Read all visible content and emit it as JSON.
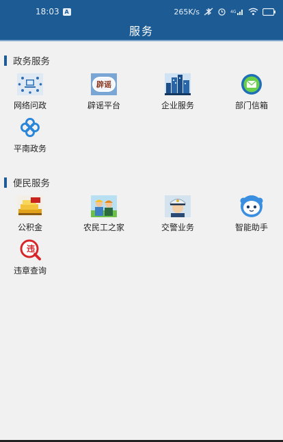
{
  "status_bar": {
    "time": "18:03",
    "time_badge": "A",
    "network_speed": "265K/s",
    "icons": [
      "bluetooth-off-icon",
      "alarm-icon",
      "signal-icon",
      "wifi-icon",
      "battery-icon"
    ]
  },
  "header": {
    "title": "服务"
  },
  "sections": [
    {
      "title": "政务服务",
      "items": [
        {
          "label": "网络问政",
          "icon": "computer-network-icon"
        },
        {
          "label": "辟谣平台",
          "icon": "rumor-refute-icon",
          "icon_text": "辟谣"
        },
        {
          "label": "企业服务",
          "icon": "city-buildings-icon"
        },
        {
          "label": "部门信箱",
          "icon": "mail-icon"
        },
        {
          "label": "平南政务",
          "icon": "pinnan-logo-icon"
        }
      ]
    },
    {
      "title": "便民服务",
      "items": [
        {
          "label": "公积金",
          "icon": "housing-fund-icon"
        },
        {
          "label": "农民工之家",
          "icon": "migrant-workers-icon"
        },
        {
          "label": "交警业务",
          "icon": "traffic-police-icon"
        },
        {
          "label": "智能助手",
          "icon": "robot-assistant-icon"
        },
        {
          "label": "违章查询",
          "icon": "violation-query-icon",
          "icon_text": "违"
        }
      ]
    }
  ],
  "colors": {
    "header_bg": "#1d5b95",
    "accent": "#1d5b95",
    "page_bg": "#f1f1f1",
    "text": "#222222"
  }
}
